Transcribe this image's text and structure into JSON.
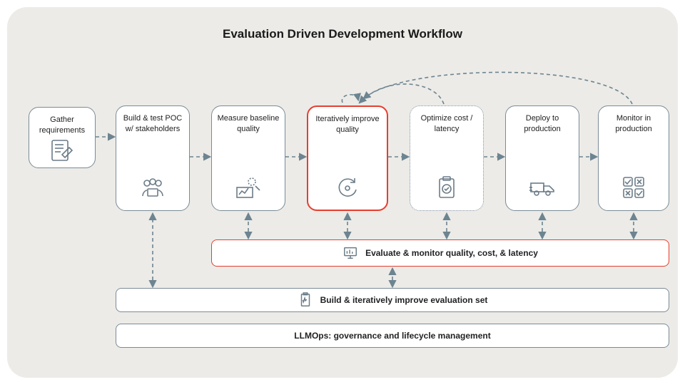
{
  "title": "Evaluation Driven Development Workflow",
  "steps": {
    "s1": {
      "label": "Gather requirements",
      "icon": "note-pencil"
    },
    "s2": {
      "label": "Build & test POC w/ stakeholders",
      "icon": "people"
    },
    "s3": {
      "label": "Measure baseline quality",
      "icon": "chart-pencil"
    },
    "s4": {
      "label": "Iteratively improve quality",
      "icon": "cycle"
    },
    "s5": {
      "label": "Optimize cost / latency",
      "icon": "clipboard-check"
    },
    "s6": {
      "label": "Deploy to production",
      "icon": "truck"
    },
    "s7": {
      "label": "Monitor in production",
      "icon": "grid-check"
    }
  },
  "bars": {
    "b1": {
      "label": "Evaluate & monitor quality, cost, & latency",
      "icon": "monitor-chart"
    },
    "b2": {
      "label": "Build & iteratively improve evaluation set",
      "icon": "clipboard-lines"
    },
    "b3": {
      "label": "LLMOps: governance and lifecycle management",
      "icon": ""
    }
  }
}
